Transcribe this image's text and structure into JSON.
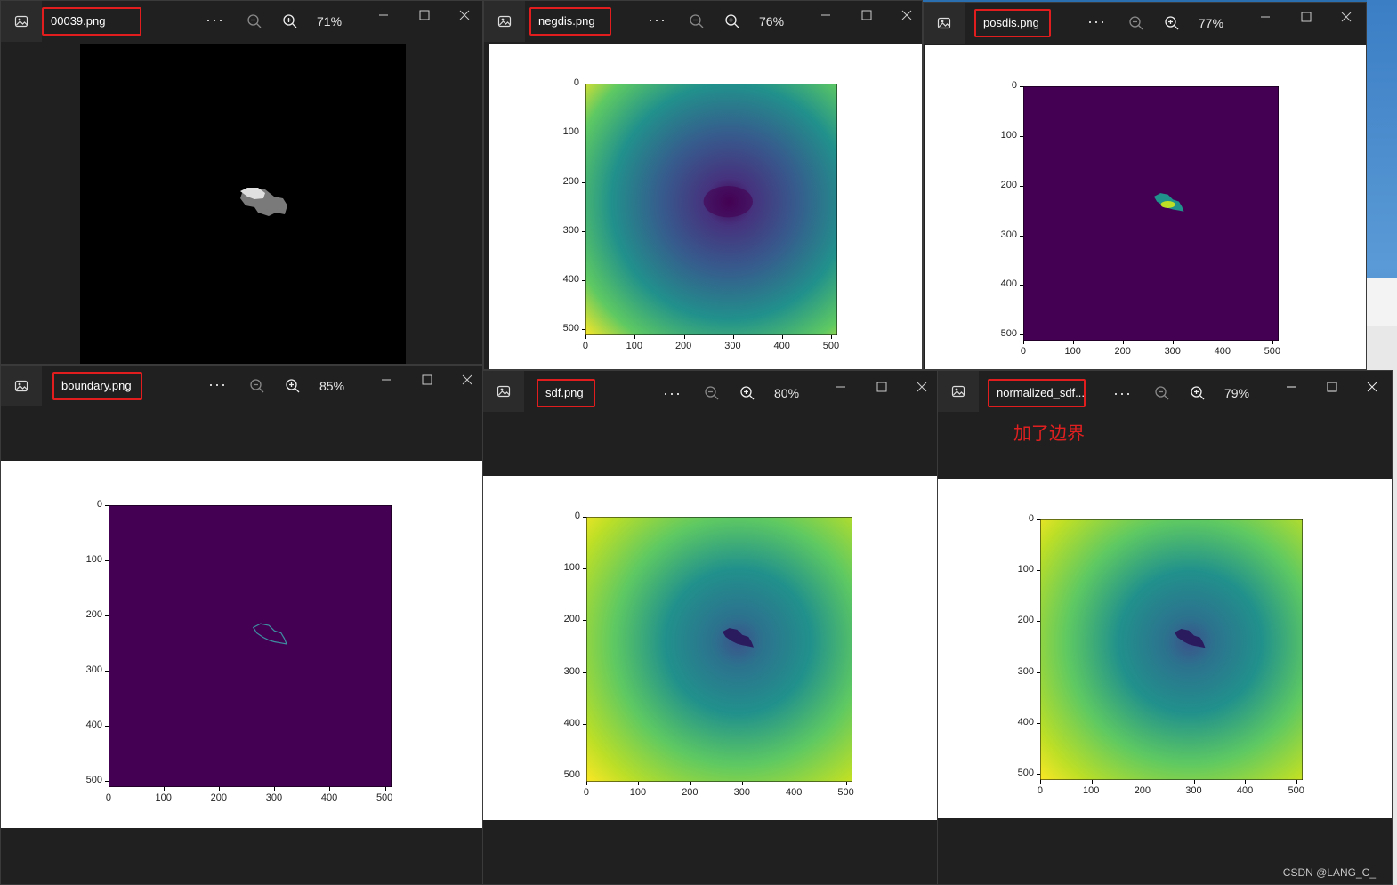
{
  "windows": [
    {
      "id": "w1",
      "filename": "00039.png",
      "zoom": "71%",
      "kind": "mask"
    },
    {
      "id": "w2",
      "filename": "negdis.png",
      "zoom": "76%",
      "kind": "negdis"
    },
    {
      "id": "w3",
      "filename": "posdis.png",
      "zoom": "77%",
      "kind": "posdis"
    },
    {
      "id": "w4",
      "filename": "boundary.png",
      "zoom": "85%",
      "kind": "boundary"
    },
    {
      "id": "w5",
      "filename": "sdf.png",
      "zoom": "80%",
      "kind": "sdf"
    },
    {
      "id": "w6",
      "filename": "normalized_sdf...",
      "zoom": "79%",
      "kind": "nsdf"
    }
  ],
  "annotation": "加了边界",
  "watermark": "CSDN @LANG_C_",
  "toolbar": {
    "more": "···"
  },
  "axis": {
    "x_ticks": [
      "0",
      "100",
      "200",
      "300",
      "400",
      "500"
    ],
    "y_ticks": [
      "0",
      "100",
      "200",
      "300",
      "400",
      "500"
    ]
  },
  "icons": {
    "app": "image-app-icon",
    "zoom_out": "zoom-out-icon",
    "zoom_in": "zoom-in-icon",
    "minimize": "minimize-icon",
    "maximize": "maximize-icon",
    "close": "close-icon"
  },
  "colors": {
    "titlebar_bg": "#202020",
    "tab_border": "#e21d1d",
    "viridis_dark": "#440154",
    "viridis_mid": "#21918c",
    "viridis_light": "#fde725"
  }
}
